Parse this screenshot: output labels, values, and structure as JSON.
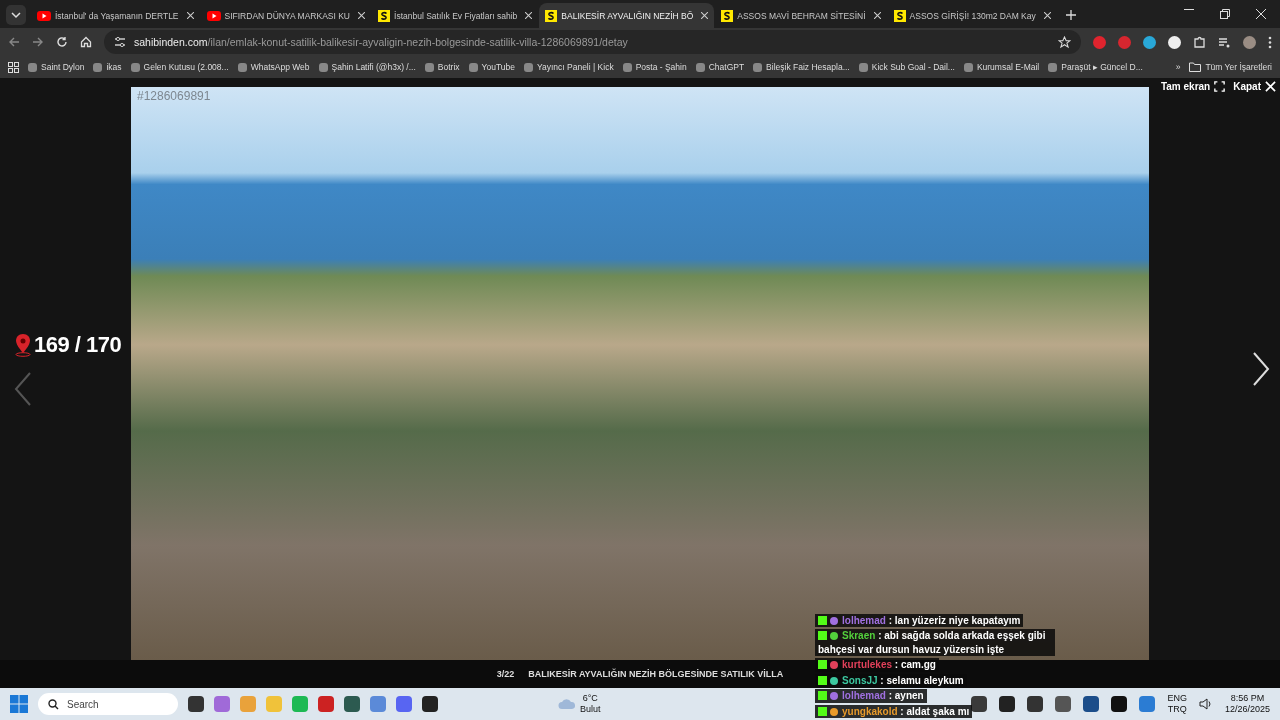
{
  "tabs": [
    {
      "title": "İstanbul' da Yaşamanın DERTLE",
      "kind": "youtube",
      "selected": false
    },
    {
      "title": "SIFIRDAN DÜNYA MARKASI KU",
      "kind": "youtube",
      "selected": false
    },
    {
      "title": "İstanbul Satılık Ev Fiyatları sahib",
      "kind": "sahibinden",
      "selected": false
    },
    {
      "title": "BALIKESİR AYVALIĞIN NEZİH BÖ",
      "kind": "sahibinden",
      "selected": true
    },
    {
      "title": "ASSOS MAVİ BEHRAM SİTESİNİ",
      "kind": "sahibinden",
      "selected": false
    },
    {
      "title": "ASSOS GİRİŞİ! 130m2 DAM Kay",
      "kind": "sahibinden",
      "selected": false
    }
  ],
  "address": {
    "domain": "sahibinden.com",
    "path": "/ilan/emlak-konut-satilik-balikesir-ayvaligin-nezih-bolgesinde-satilik-villa-1286069891/detay"
  },
  "bookmarks": [
    "Saint Dylon",
    "ikas",
    "Gelen Kutusu (2.008...",
    "WhatsApp Web",
    "Şahin Latifi (@h3x) /...",
    "Botrix",
    "YouTube",
    "Yayıncı Paneli | Kick",
    "Posta - Şahin",
    "ChatGPT",
    "Bileşik Faiz Hesapla...",
    "Kick Sub Goal - Dail...",
    "Kurumsal E-Mail",
    "Paraşüt ▸ Güncel D..."
  ],
  "bookmarks_more": "»",
  "all_bookmarks": "Tüm Yer İşaretleri",
  "viewer": {
    "listing_id": "#1286069891",
    "counter": "169 / 170",
    "fullscreen": "Tam ekran",
    "close": "Kapat",
    "photo_index": "3/22",
    "caption": "BALIKESİR AYVALIĞIN NEZİH BÖLGESİNDE SATILIK VİLLA"
  },
  "chat_separator": ":",
  "chat": [
    {
      "user": "lolhemad",
      "color": "#a070e0",
      "text": "lan yüzeriz niye kapatayım"
    },
    {
      "user": "Skraen",
      "color": "#53d13c",
      "text": "abi sağda solda arkada eşşek gibi bahçesi var dursun havuz yüzersin işte"
    },
    {
      "user": "kurtulekes",
      "color": "#e0405a",
      "text": "cam.gg"
    },
    {
      "user": "SonsJJ",
      "color": "#3cc8a0",
      "text": "selamu aleykum"
    },
    {
      "user": "lolhemad",
      "color": "#a070e0",
      "text": "aynen"
    },
    {
      "user": "yungkakold",
      "color": "#e89a2a",
      "text": "aldat şaka mı"
    }
  ],
  "taskbar": {
    "search_placeholder": "Search",
    "weather_temp": "6°C",
    "weather_text": "Bulut",
    "language": "ENG",
    "layout": "TRQ",
    "time": "8:56 PM",
    "date": "12/26/2025"
  }
}
